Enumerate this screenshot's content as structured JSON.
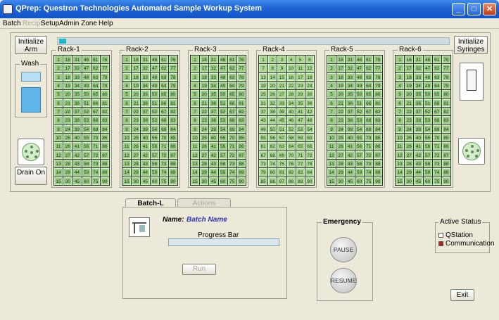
{
  "window": {
    "title": "QPrep: Questron Technologies Automated Sample Workup System",
    "min": "_",
    "max": "□",
    "close": "✕"
  },
  "menu": [
    {
      "label": "Batch",
      "enabled": true
    },
    {
      "label": "Recipe",
      "enabled": false
    },
    {
      "label": "Setup",
      "enabled": true
    },
    {
      "label": "Admin Zone",
      "enabled": true
    },
    {
      "label": "Help",
      "enabled": true
    }
  ],
  "controls": {
    "initialize_arm": "Initialize Arm",
    "initialize_syringes": "Initialize Syringes",
    "drain_on": "Drain On",
    "wash": "Wash"
  },
  "racks": [
    {
      "label": "Rack-1",
      "cols": [
        [
          1,
          2,
          3,
          4,
          5,
          6,
          7,
          8,
          9,
          10,
          11,
          12,
          13,
          14,
          15
        ],
        [
          16,
          17,
          18,
          19,
          20,
          21,
          22,
          23,
          24,
          25,
          26,
          27,
          28,
          29,
          30
        ],
        [
          31,
          32,
          33,
          34,
          35,
          36,
          37,
          38,
          39,
          40,
          41,
          42,
          43,
          44,
          45
        ],
        [
          46,
          47,
          48,
          49,
          50,
          51,
          52,
          53,
          54,
          55,
          56,
          57,
          58,
          59,
          60
        ],
        [
          61,
          62,
          63,
          64,
          65,
          66,
          67,
          68,
          69,
          70,
          71,
          72,
          73,
          74,
          75
        ],
        [
          76,
          77,
          78,
          79,
          80,
          81,
          82,
          83,
          84,
          85,
          86,
          87,
          88,
          89,
          90
        ]
      ]
    },
    {
      "label": "Rack-2",
      "cols": [
        [
          1,
          2,
          3,
          4,
          5,
          6,
          7,
          8,
          9,
          10,
          11,
          12,
          13,
          14,
          15
        ],
        [
          16,
          17,
          18,
          19,
          20,
          21,
          22,
          23,
          24,
          25,
          26,
          27,
          28,
          29,
          30
        ],
        [
          31,
          32,
          33,
          34,
          35,
          36,
          37,
          38,
          39,
          40,
          41,
          42,
          43,
          44,
          45
        ],
        [
          46,
          47,
          48,
          49,
          50,
          51,
          52,
          53,
          54,
          55,
          56,
          57,
          58,
          59,
          60
        ],
        [
          61,
          62,
          63,
          64,
          65,
          66,
          67,
          68,
          69,
          70,
          71,
          72,
          73,
          74,
          75
        ],
        [
          76,
          77,
          78,
          79,
          80,
          81,
          82,
          83,
          84,
          85,
          86,
          87,
          88,
          89,
          90
        ]
      ]
    },
    {
      "label": "Rack-3",
      "cols": [
        [
          1,
          2,
          3,
          4,
          5,
          6,
          7,
          8,
          9,
          10,
          11,
          12,
          13,
          14,
          15
        ],
        [
          16,
          17,
          18,
          19,
          20,
          21,
          22,
          23,
          24,
          25,
          26,
          27,
          28,
          29,
          30
        ],
        [
          31,
          32,
          33,
          34,
          35,
          36,
          37,
          38,
          39,
          40,
          41,
          42,
          43,
          44,
          45
        ],
        [
          46,
          47,
          48,
          49,
          50,
          51,
          52,
          53,
          54,
          55,
          56,
          57,
          58,
          59,
          60
        ],
        [
          61,
          62,
          63,
          64,
          65,
          66,
          67,
          68,
          69,
          70,
          71,
          72,
          73,
          74,
          75
        ],
        [
          76,
          77,
          78,
          79,
          80,
          81,
          82,
          83,
          84,
          85,
          86,
          87,
          88,
          89,
          90
        ]
      ]
    },
    {
      "label": "Rack-4",
      "cols": [
        [
          1,
          7,
          13,
          19,
          25,
          31,
          37,
          43,
          49,
          55,
          61,
          67,
          73,
          79,
          85
        ],
        [
          2,
          8,
          14,
          20,
          26,
          32,
          38,
          44,
          50,
          56,
          62,
          68,
          74,
          80,
          86
        ],
        [
          3,
          9,
          15,
          21,
          27,
          33,
          39,
          45,
          51,
          57,
          63,
          69,
          75,
          81,
          87
        ],
        [
          4,
          10,
          16,
          22,
          28,
          34,
          40,
          46,
          52,
          58,
          64,
          70,
          76,
          82,
          88
        ],
        [
          5,
          11,
          17,
          23,
          29,
          35,
          41,
          47,
          53,
          59,
          65,
          71,
          77,
          83,
          89
        ],
        [
          6,
          12,
          18,
          24,
          30,
          36,
          42,
          48,
          54,
          60,
          66,
          72,
          78,
          84,
          90
        ]
      ]
    },
    {
      "label": "Rack-5",
      "cols": [
        [
          1,
          2,
          3,
          4,
          5,
          6,
          7,
          8,
          9,
          10,
          11,
          12,
          13,
          14,
          15
        ],
        [
          16,
          17,
          18,
          19,
          20,
          21,
          22,
          23,
          24,
          25,
          26,
          27,
          28,
          29,
          30
        ],
        [
          31,
          32,
          33,
          34,
          35,
          36,
          37,
          38,
          39,
          40,
          41,
          42,
          43,
          44,
          45
        ],
        [
          46,
          47,
          48,
          49,
          50,
          51,
          52,
          53,
          54,
          55,
          56,
          57,
          58,
          59,
          60
        ],
        [
          61,
          62,
          63,
          64,
          65,
          66,
          67,
          68,
          69,
          70,
          71,
          72,
          73,
          74,
          75
        ],
        [
          76,
          77,
          78,
          79,
          80,
          81,
          82,
          83,
          84,
          85,
          86,
          87,
          88,
          89,
          90
        ]
      ]
    },
    {
      "label": "Rack-6",
      "cols": [
        [
          1,
          2,
          3,
          4,
          5,
          6,
          7,
          8,
          9,
          10,
          11,
          12,
          13,
          14,
          15
        ],
        [
          16,
          17,
          18,
          19,
          20,
          21,
          22,
          23,
          24,
          25,
          26,
          27,
          28,
          29,
          30
        ],
        [
          31,
          32,
          33,
          34,
          35,
          36,
          37,
          38,
          39,
          40,
          41,
          42,
          43,
          44,
          45
        ],
        [
          46,
          47,
          48,
          49,
          50,
          51,
          52,
          53,
          54,
          55,
          56,
          57,
          58,
          59,
          60
        ],
        [
          61,
          62,
          63,
          64,
          65,
          66,
          67,
          68,
          69,
          70,
          71,
          72,
          73,
          74,
          75
        ],
        [
          76,
          77,
          78,
          79,
          80,
          81,
          82,
          83,
          84,
          85,
          86,
          87,
          88,
          89,
          90
        ]
      ]
    }
  ],
  "tabs": {
    "batch": "Batch-L",
    "actions": "Actions"
  },
  "batch": {
    "name_label": "Name:",
    "name_value": "Batch Name",
    "progress_label": "Progress Bar",
    "run": "Run"
  },
  "emergency": {
    "label": "Emergency",
    "pause": "PAUSE",
    "resume": "RESUME"
  },
  "status": {
    "label": "Active Status",
    "items": [
      {
        "label": "QStation",
        "color": "#ffffff"
      },
      {
        "label": "Communication",
        "color": "#c0201a"
      }
    ]
  },
  "exit": "Exit",
  "colors": {
    "titlebar": "#1f63d3",
    "cell": "#9ccb83",
    "progress_accent": "#1fb8c6",
    "name_value": "#2b35b4"
  }
}
